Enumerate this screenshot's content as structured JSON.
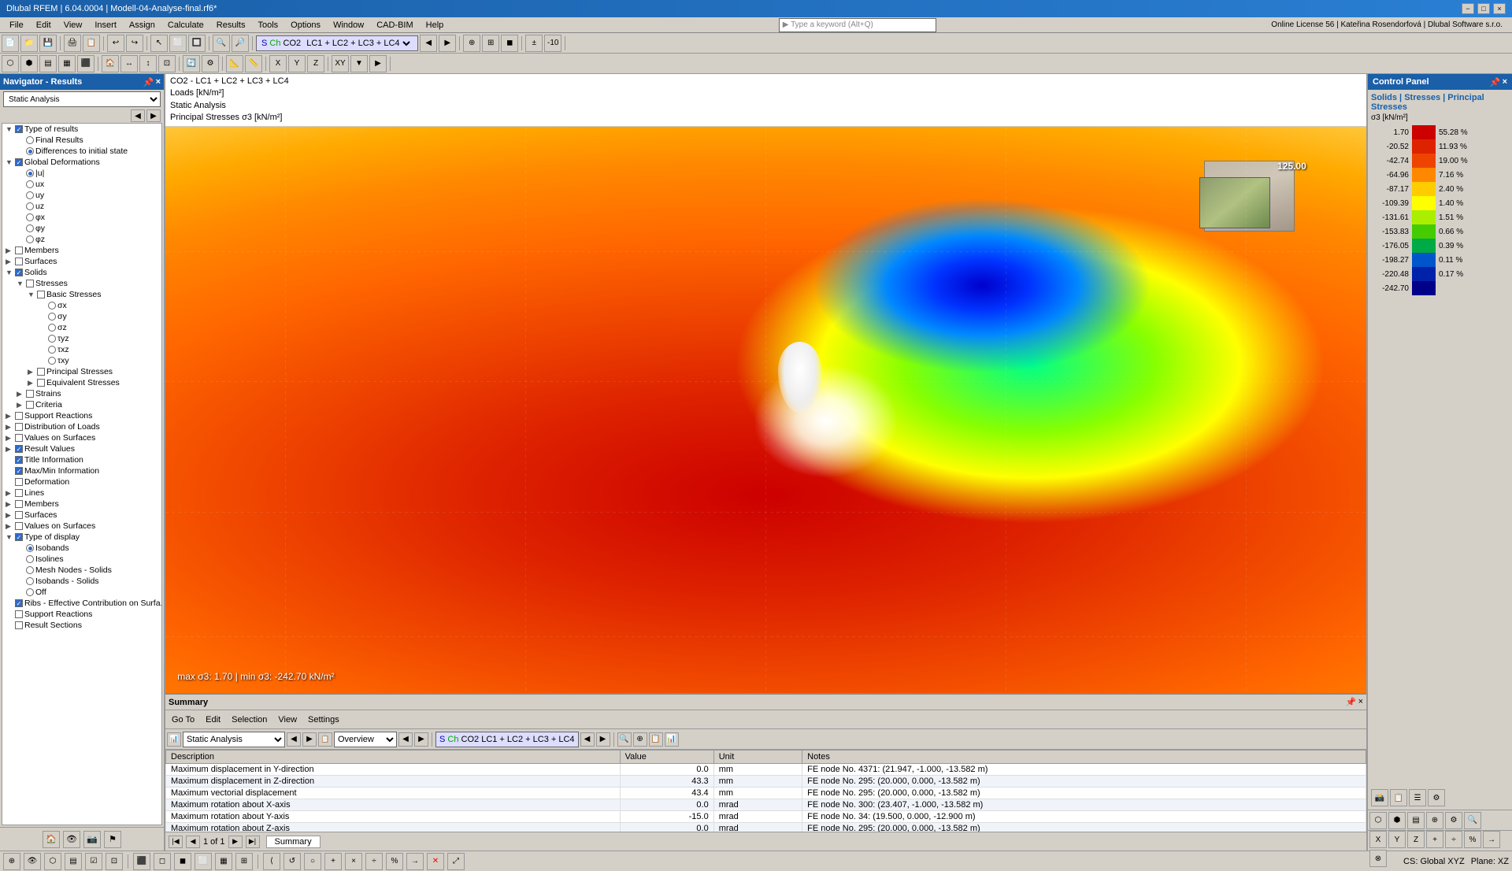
{
  "window": {
    "title": "Dlubal RFEM | 6.04.0004 | Modell-04-Analyse-final.rf6*"
  },
  "titlebar": {
    "controls": [
      "−",
      "□",
      "×"
    ]
  },
  "menubar": {
    "items": [
      "File",
      "Edit",
      "View",
      "Insert",
      "Assign",
      "Calculate",
      "Results",
      "Tools",
      "Options",
      "Window",
      "CAD-BIM",
      "Help"
    ]
  },
  "toolbar": {
    "combo_label": "S Ch  CO2  LC1 + LC2 + LC3 + LC4"
  },
  "navigator": {
    "title": "Navigator - Results",
    "combo_value": "Static Analysis",
    "tree": [
      {
        "indent": 0,
        "toggle": "▼",
        "icon": "📁",
        "label": "Type of results",
        "checkbox": true,
        "checked": true
      },
      {
        "indent": 1,
        "toggle": "",
        "icon": "🔵",
        "label": "Final Results",
        "radio": true,
        "checked": false
      },
      {
        "indent": 1,
        "toggle": "",
        "icon": "🔵",
        "label": "Differences to initial state",
        "radio": true,
        "checked": true
      },
      {
        "indent": 0,
        "toggle": "▼",
        "icon": "📁",
        "label": "Global Deformations",
        "checkbox": true,
        "checked": true
      },
      {
        "indent": 1,
        "toggle": "",
        "icon": "🔵",
        "label": "|u|",
        "radio": true,
        "checked": true
      },
      {
        "indent": 1,
        "toggle": "",
        "icon": "🔵",
        "label": "ux",
        "radio": true,
        "checked": false
      },
      {
        "indent": 1,
        "toggle": "",
        "icon": "🔵",
        "label": "uy",
        "radio": true,
        "checked": false
      },
      {
        "indent": 1,
        "toggle": "",
        "icon": "🔵",
        "label": "uz",
        "radio": true,
        "checked": false
      },
      {
        "indent": 1,
        "toggle": "",
        "icon": "🔵",
        "label": "φx",
        "radio": true,
        "checked": false
      },
      {
        "indent": 1,
        "toggle": "",
        "icon": "🔵",
        "label": "φy",
        "radio": true,
        "checked": false
      },
      {
        "indent": 1,
        "toggle": "",
        "icon": "🔵",
        "label": "φz",
        "radio": true,
        "checked": false
      },
      {
        "indent": 0,
        "toggle": "▶",
        "icon": "📁",
        "label": "Members",
        "checkbox": false,
        "checked": false
      },
      {
        "indent": 0,
        "toggle": "▶",
        "icon": "📁",
        "label": "Surfaces",
        "checkbox": false,
        "checked": false
      },
      {
        "indent": 0,
        "toggle": "▼",
        "icon": "📁",
        "label": "Solids",
        "checkbox": true,
        "checked": true
      },
      {
        "indent": 1,
        "toggle": "▼",
        "icon": "📁",
        "label": "Stresses",
        "checkbox": false,
        "checked": false
      },
      {
        "indent": 2,
        "toggle": "▼",
        "icon": "📁",
        "label": "Basic Stresses",
        "checkbox": false,
        "checked": false
      },
      {
        "indent": 3,
        "toggle": "",
        "icon": "🔵",
        "label": "σx",
        "radio": true,
        "checked": false
      },
      {
        "indent": 3,
        "toggle": "",
        "icon": "🔵",
        "label": "σy",
        "radio": true,
        "checked": false
      },
      {
        "indent": 3,
        "toggle": "",
        "icon": "🔵",
        "label": "σz",
        "radio": true,
        "checked": false
      },
      {
        "indent": 3,
        "toggle": "",
        "icon": "🔵",
        "label": "τyz",
        "radio": true,
        "checked": false
      },
      {
        "indent": 3,
        "toggle": "",
        "icon": "🔵",
        "label": "τxz",
        "radio": true,
        "checked": false
      },
      {
        "indent": 3,
        "toggle": "",
        "icon": "🔵",
        "label": "τxy",
        "radio": true,
        "checked": false
      },
      {
        "indent": 2,
        "toggle": "▶",
        "icon": "📁",
        "label": "Principal Stresses",
        "checkbox": false,
        "checked": false
      },
      {
        "indent": 2,
        "toggle": "▶",
        "icon": "📁",
        "label": "Equivalent Stresses",
        "checkbox": false,
        "checked": false
      },
      {
        "indent": 1,
        "toggle": "▶",
        "icon": "📁",
        "label": "Strains",
        "checkbox": false,
        "checked": false
      },
      {
        "indent": 1,
        "toggle": "▶",
        "icon": "📁",
        "label": "Criteria",
        "checkbox": false,
        "checked": false
      },
      {
        "indent": 0,
        "toggle": "▶",
        "icon": "📁",
        "label": "Support Reactions",
        "checkbox": false,
        "checked": false
      },
      {
        "indent": 0,
        "toggle": "▶",
        "icon": "📁",
        "label": "Distribution of Loads",
        "checkbox": false,
        "checked": false
      },
      {
        "indent": 0,
        "toggle": "▶",
        "icon": "📁",
        "label": "Values on Surfaces",
        "checkbox": false,
        "checked": false
      },
      {
        "indent": 0,
        "toggle": "▶",
        "icon": "📁",
        "label": "Result Values",
        "checkbox": true,
        "checked": true
      },
      {
        "indent": 0,
        "toggle": "",
        "icon": "📋",
        "label": "Title Information",
        "checkbox": true,
        "checked": true
      },
      {
        "indent": 0,
        "toggle": "",
        "icon": "📋",
        "label": "Max/Min Information",
        "checkbox": true,
        "checked": true
      },
      {
        "indent": 0,
        "toggle": "",
        "icon": "📋",
        "label": "Deformation",
        "checkbox": false,
        "checked": false
      },
      {
        "indent": 0,
        "toggle": "▶",
        "icon": "📁",
        "label": "Lines",
        "checkbox": false,
        "checked": false
      },
      {
        "indent": 0,
        "toggle": "▶",
        "icon": "📁",
        "label": "Members",
        "checkbox": false,
        "checked": false
      },
      {
        "indent": 0,
        "toggle": "▶",
        "icon": "📁",
        "label": "Surfaces",
        "checkbox": false,
        "checked": false
      },
      {
        "indent": 0,
        "toggle": "▶",
        "icon": "📁",
        "label": "Values on Surfaces",
        "checkbox": false,
        "checked": false
      },
      {
        "indent": 0,
        "toggle": "▼",
        "icon": "📁",
        "label": "Type of display",
        "checkbox": true,
        "checked": true
      },
      {
        "indent": 1,
        "toggle": "",
        "icon": "🔵",
        "label": "Isobands",
        "radio": true,
        "checked": true
      },
      {
        "indent": 1,
        "toggle": "",
        "icon": "🔵",
        "label": "Isolines",
        "radio": true,
        "checked": false
      },
      {
        "indent": 1,
        "toggle": "",
        "icon": "🔵",
        "label": "Mesh Nodes - Solids",
        "radio": true,
        "checked": false
      },
      {
        "indent": 1,
        "toggle": "",
        "icon": "🔵",
        "label": "Isobands - Solids",
        "radio": true,
        "checked": false
      },
      {
        "indent": 1,
        "toggle": "",
        "icon": "🔵",
        "label": "Off",
        "radio": true,
        "checked": false
      },
      {
        "indent": 0,
        "toggle": "",
        "icon": "📋",
        "label": "Ribs - Effective Contribution on Surfa...",
        "checkbox": true,
        "checked": true
      },
      {
        "indent": 0,
        "toggle": "",
        "icon": "📋",
        "label": "Support Reactions",
        "checkbox": false,
        "checked": false
      },
      {
        "indent": 0,
        "toggle": "",
        "icon": "📋",
        "label": "Result Sections",
        "checkbox": false,
        "checked": false
      }
    ]
  },
  "infobar": {
    "line1": "CO2 - LC1 + LC2 + LC3 + LC4",
    "line2": "Loads [kN/m²]",
    "line3": "Static Analysis",
    "line4": "Principal Stresses σ3 [kN/m²]"
  },
  "viewport": {
    "dim_label": "125.00",
    "stress_label": "max σ3: 1.70 | min σ3: -242.70 kN/m²"
  },
  "control_panel": {
    "title": "Control Panel",
    "subtitle": "Solids | Stresses | Principal Stresses",
    "subtitle2": "σ3 [kN/m²]",
    "scale": [
      {
        "value": "1.70",
        "color": "#cc0000",
        "pct": "55.28 %"
      },
      {
        "value": "-20.52",
        "color": "#dd2200",
        "pct": "11.93 %"
      },
      {
        "value": "-42.74",
        "color": "#ee4400",
        "pct": "19.00 %"
      },
      {
        "value": "-64.96",
        "color": "#ff8800",
        "pct": "7.16 %"
      },
      {
        "value": "-87.17",
        "color": "#ffcc00",
        "pct": "2.40 %"
      },
      {
        "value": "-109.39",
        "color": "#ffff00",
        "pct": "1.40 %"
      },
      {
        "value": "-131.61",
        "color": "#aaee00",
        "pct": "1.51 %"
      },
      {
        "value": "-153.83",
        "color": "#44cc00",
        "pct": "0.66 %"
      },
      {
        "value": "-176.05",
        "color": "#00aa44",
        "pct": "0.39 %"
      },
      {
        "value": "-198.27",
        "color": "#0055cc",
        "pct": "0.11 %"
      },
      {
        "value": "-220.48",
        "color": "#0022aa",
        "pct": "0.17 %"
      },
      {
        "value": "-242.70",
        "color": "#000088",
        "pct": ""
      }
    ]
  },
  "summary": {
    "title": "Summary",
    "menus": [
      "Go To",
      "Edit",
      "Selection",
      "View",
      "Settings"
    ],
    "combo1": "Static Analysis",
    "combo2": "Overview",
    "toolbar_combo": "S Ch  CO2  LC1 + LC2 + LC3 + LC4",
    "columns": [
      "Description",
      "Value",
      "Unit",
      "Notes"
    ],
    "rows": [
      {
        "desc": "Maximum displacement in Y-direction",
        "value": "0.0",
        "unit": "mm",
        "notes": "FE node No. 4371: (21.947, -1.000, -13.582 m)"
      },
      {
        "desc": "Maximum displacement in Z-direction",
        "value": "43.3",
        "unit": "mm",
        "notes": "FE node No. 295: (20.000, 0.000, -13.582 m)"
      },
      {
        "desc": "Maximum vectorial displacement",
        "value": "43.4",
        "unit": "mm",
        "notes": "FE node No. 295: (20.000, 0.000, -13.582 m)"
      },
      {
        "desc": "Maximum rotation about X-axis",
        "value": "0.0",
        "unit": "mrad",
        "notes": "FE node No. 300: (23.407, -1.000, -13.582 m)"
      },
      {
        "desc": "Maximum rotation about Y-axis",
        "value": "-15.0",
        "unit": "mrad",
        "notes": "FE node No. 34: (19.500, 0.000, -12.900 m)"
      },
      {
        "desc": "Maximum rotation about Z-axis",
        "value": "0.0",
        "unit": "mrad",
        "notes": "FE node No. 295: (20.000, 0.000, -13.582 m)"
      }
    ],
    "nav": {
      "page_info": "1 of 1",
      "tab_label": "Summary"
    }
  },
  "bottom_bar": {
    "cs_label": "CS: Global XYZ",
    "plane_label": "Plane: XZ"
  }
}
